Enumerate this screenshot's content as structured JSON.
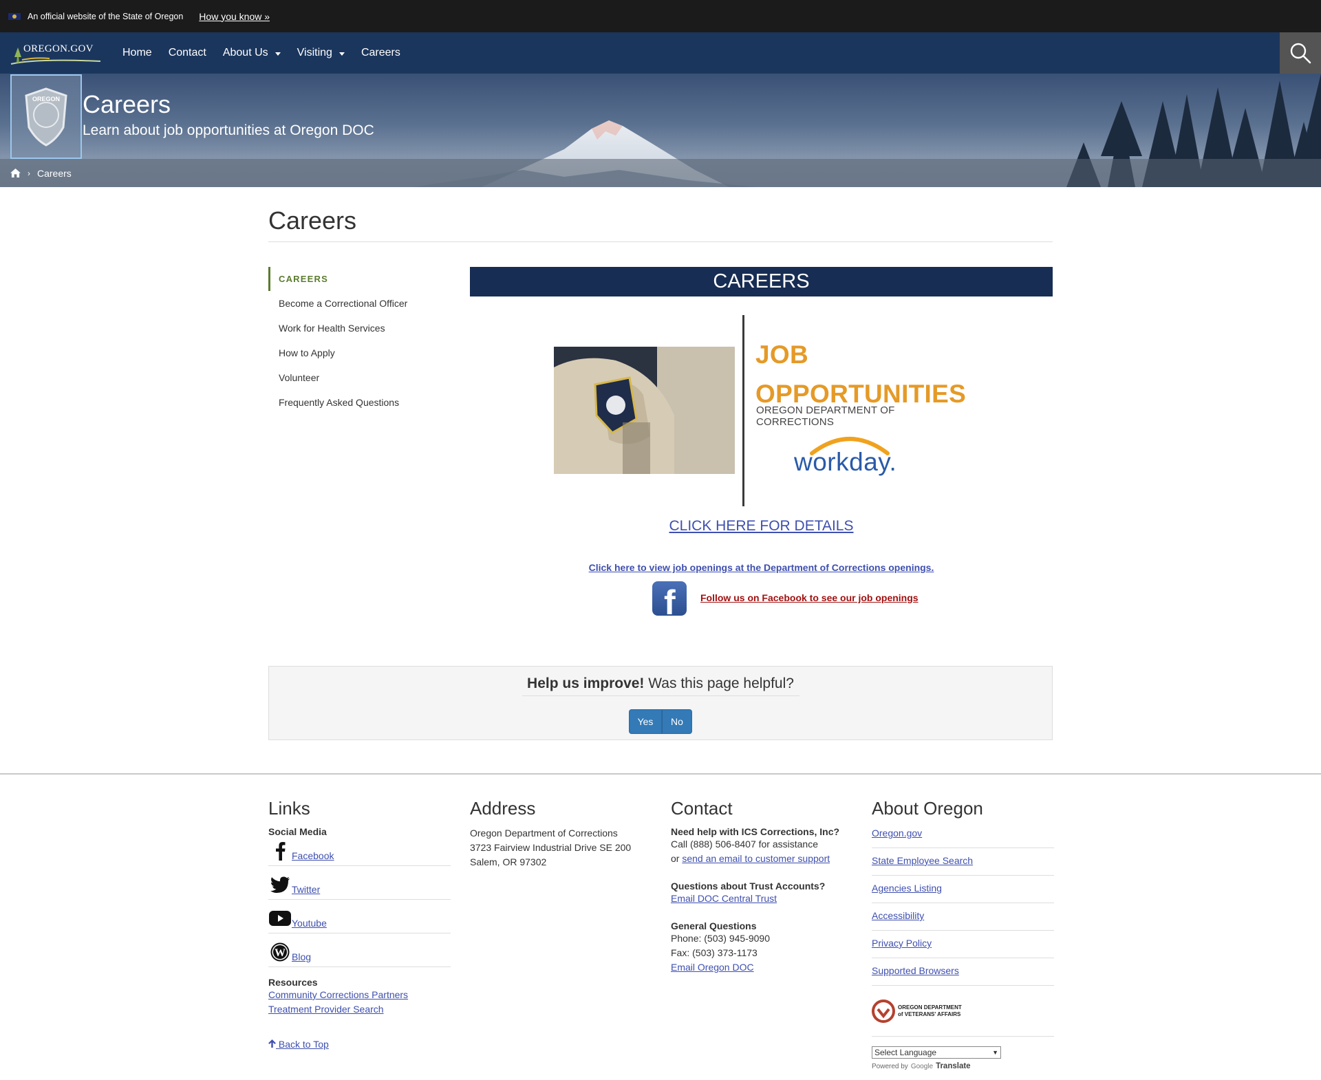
{
  "gov_bar": {
    "official_text": "An official website of the State of Oregon",
    "how_you_know": "How you know »"
  },
  "nav": {
    "logo_text": "OREGON.GOV",
    "items": [
      {
        "label": "Home"
      },
      {
        "label": "Contact"
      },
      {
        "label": "About Us"
      },
      {
        "label": "Visiting"
      },
      {
        "label": "Careers"
      }
    ]
  },
  "hero": {
    "title": "Careers",
    "subtitle": "Learn about job opportunities at Oregon DOC",
    "seal_text_top": "OREGON",
    "breadcrumb_current": "Careers"
  },
  "page": {
    "title": "Careers"
  },
  "side_nav": {
    "heading": "CAREERS",
    "items": [
      "Become a Correctional Officer",
      "Work for Health Services",
      "How to Apply",
      "Volunteer",
      "Frequently Asked Questions"
    ]
  },
  "main": {
    "banner": "CAREERS",
    "graphic": {
      "line1": "JOB",
      "line2": "OPPORTUNITIES",
      "dept": "OREGON DEPARTMENT OF CORRECTIONS",
      "workday": "workday."
    },
    "click_details": "CLICK HERE FOR DETAILS",
    "job_openings": "Click here to view job openings at the Department of Corrections openings.",
    "facebook_follow": "Follow us on Facebook to see our job openings"
  },
  "feedback": {
    "bold": "Help us improve!",
    "question": "Was this page helpful?",
    "yes": "Yes",
    "no": "No"
  },
  "footer": {
    "links": {
      "title": "Links",
      "social_label": "Social Media",
      "social": [
        {
          "label": "Facebook",
          "icon": "facebook-icon"
        },
        {
          "label": "Twitter",
          "icon": "twitter-icon"
        },
        {
          "label": "Youtube",
          "icon": "youtube-icon"
        },
        {
          "label": "Blog",
          "icon": "wordpress-icon"
        }
      ],
      "resources_label": "Resources",
      "resources": [
        "Community Corrections Partners",
        "Treatment Provider Search"
      ],
      "back_to_top": " Back to Top"
    },
    "address": {
      "title": "Address",
      "lines": [
        "Oregon Department of Corrections",
        "3723 Fairview Industrial Drive SE 200",
        "Salem, OR 97302"
      ]
    },
    "contact": {
      "title": "Contact",
      "ics_label": "Need help with ICS Corrections, Inc?",
      "ics_call": "Call (888) 506-8407 for assistance",
      "ics_or": "or ",
      "ics_email": "send an email to customer support",
      "trust_label": "Questions about Trust Accounts?",
      "trust_email": "Email DOC Central Trust",
      "general_label": "General Questions",
      "phone": "Phone: (503) 945-9090",
      "fax": "Fax: (503) 373-1173",
      "general_email": "Email Oregon DOC"
    },
    "about": {
      "title": "About Oregon",
      "links": [
        "Oregon.gov",
        "State Employee Search",
        "Agencies Listing",
        "Accessibility",
        "Privacy Policy",
        "Supported Browsers"
      ],
      "vet_logo_line1": "OREGON DEPARTMENT",
      "vet_logo_line2": "of VETERANS' AFFAIRS",
      "select_language": "Select Language",
      "powered_by": "Powered by",
      "google": "Google",
      "translate": "Translate"
    }
  }
}
